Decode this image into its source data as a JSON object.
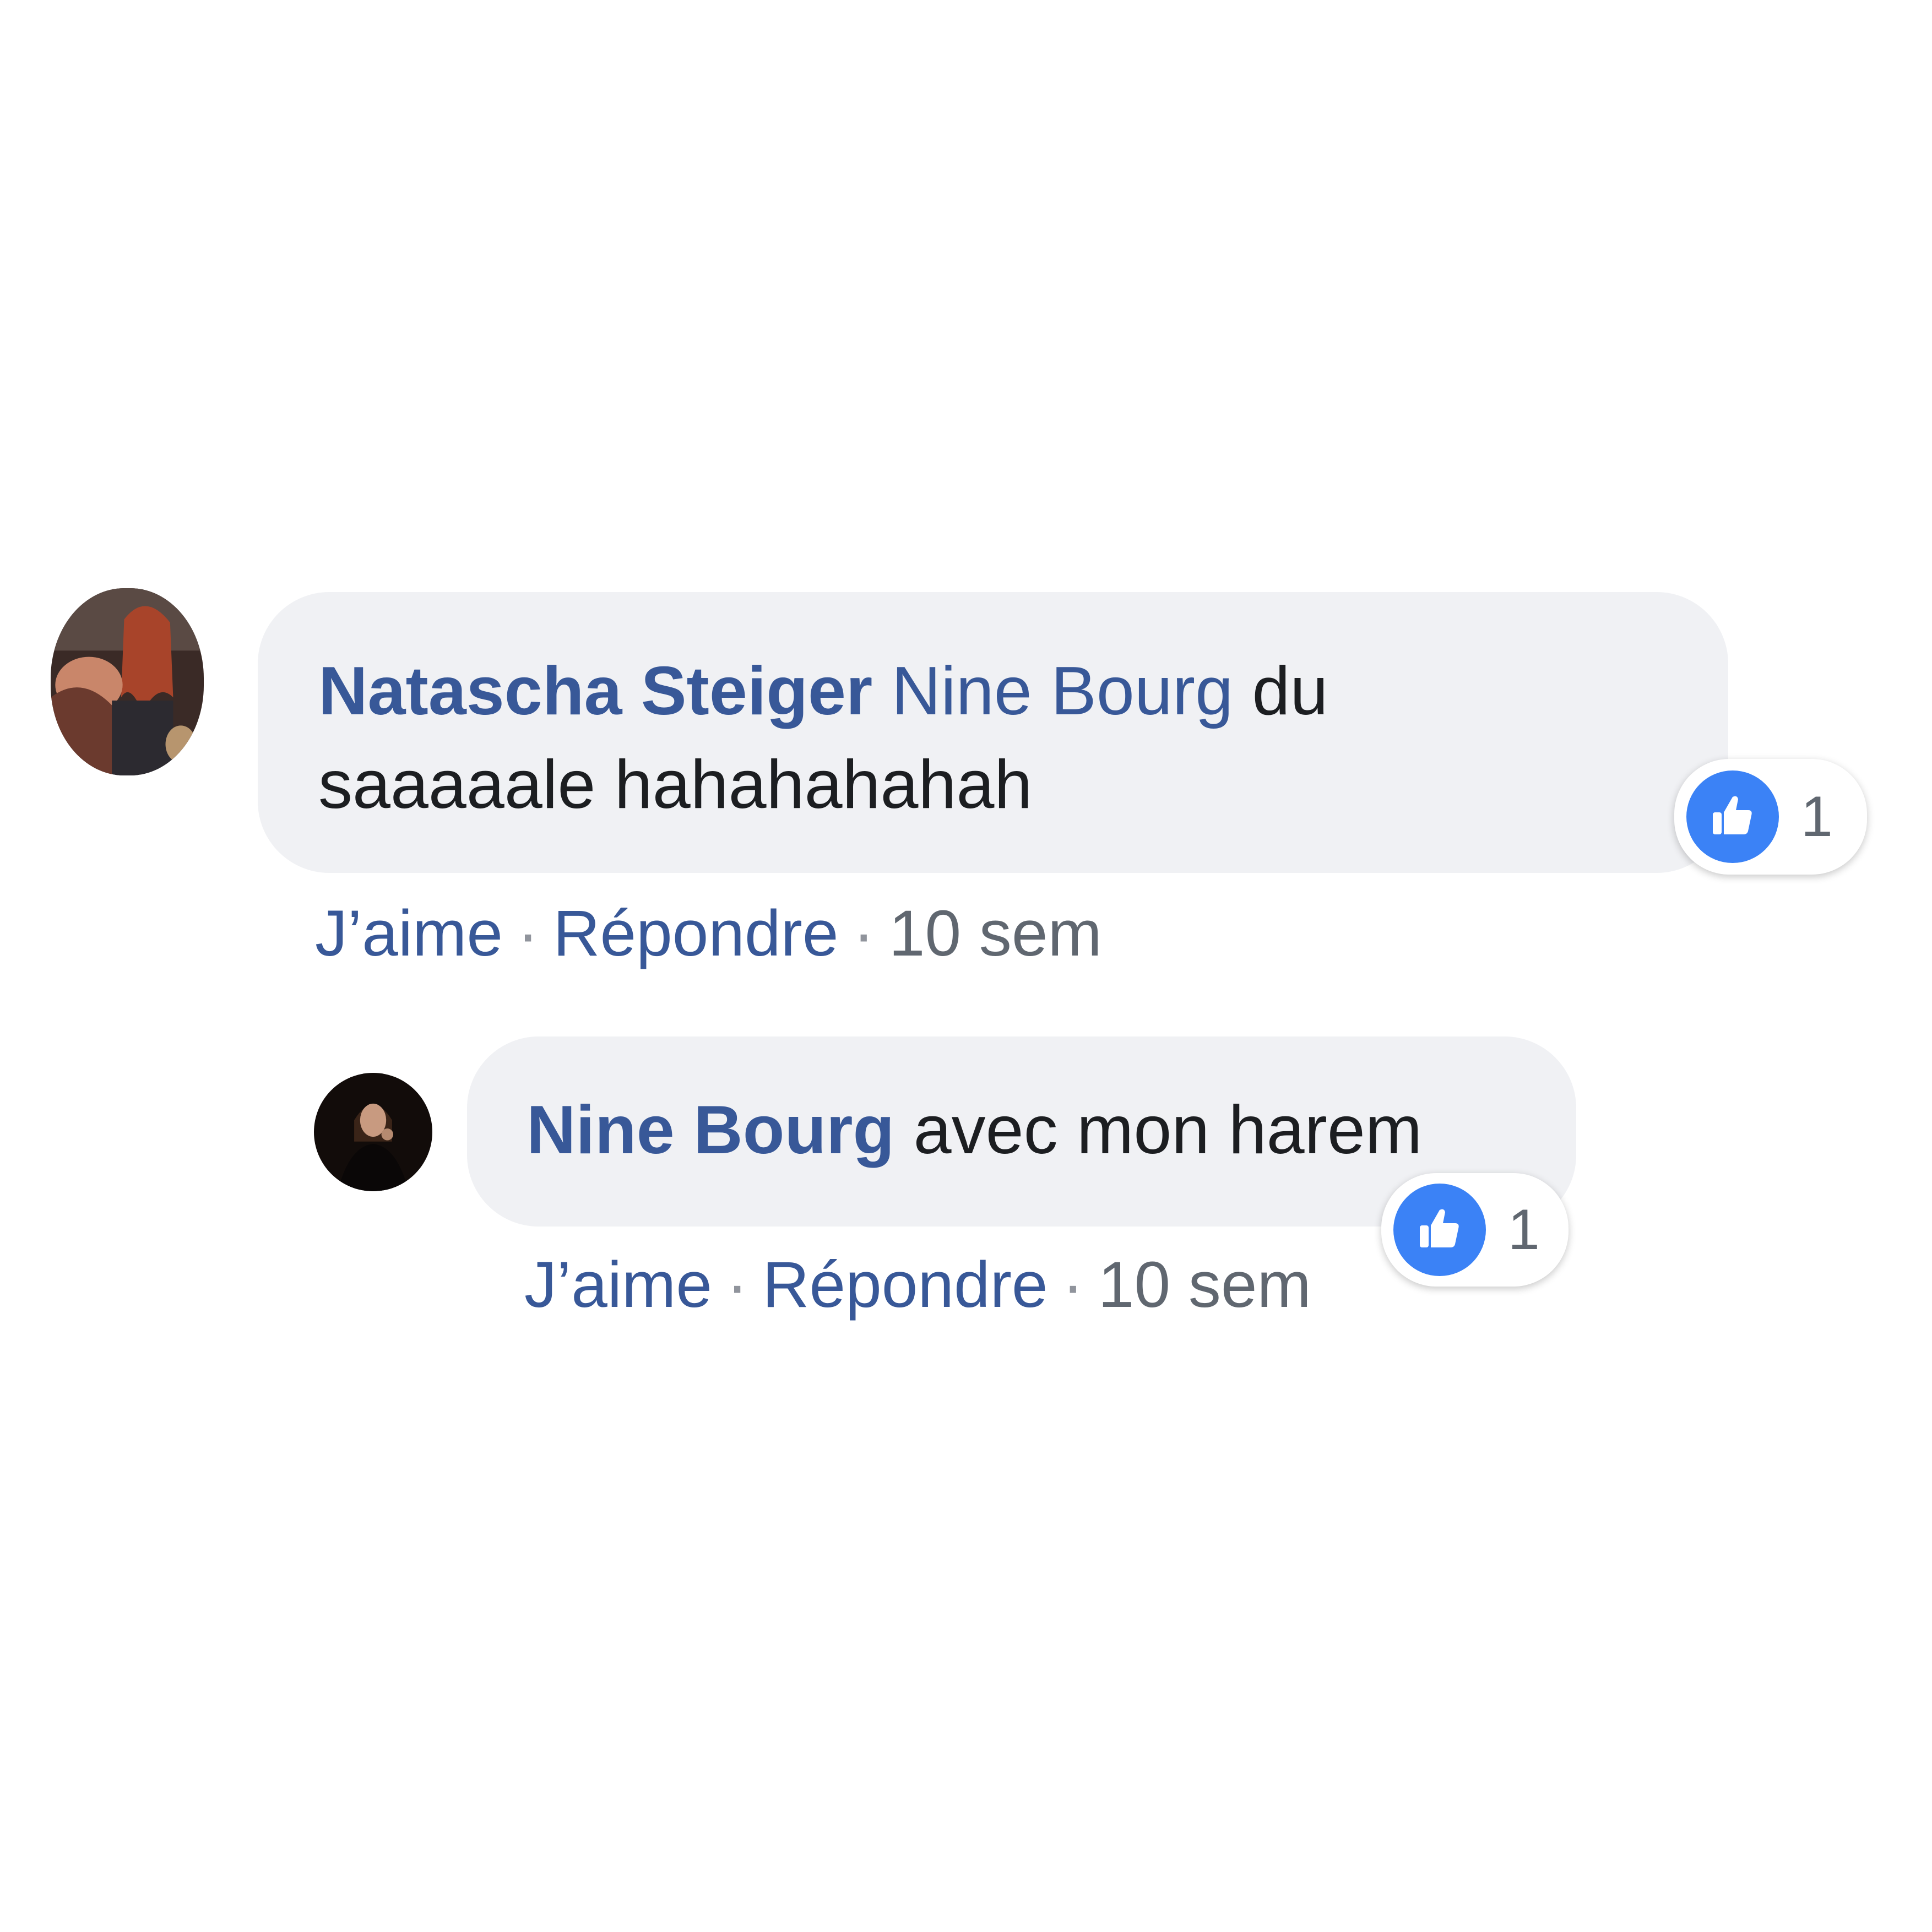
{
  "comments": [
    {
      "author": "Natascha Steiger",
      "mention": "Nine Bourg",
      "text_line1": "du",
      "text_line2": "saaaaale hahahahahah",
      "like_label": "J’aime",
      "reply_label": "Répondre",
      "separator": "·",
      "timestamp": "10 sem",
      "reaction_count": "1",
      "reaction_icon": "thumbs-up-icon",
      "avatar_icon": "profile-photo"
    },
    {
      "author": "Nine Bourg",
      "text": "avec mon harem",
      "like_label": "J’aime",
      "reply_label": "Répondre",
      "separator": "·",
      "timestamp": "10 sem",
      "reaction_count": "1",
      "reaction_icon": "thumbs-up-icon",
      "avatar_icon": "profile-photo"
    }
  ],
  "colors": {
    "link_blue": "#385898",
    "bubble_bg": "#f0f1f4",
    "like_blue": "#3b82f6",
    "text_dark": "#1c1e21",
    "meta_grey": "#606770"
  }
}
